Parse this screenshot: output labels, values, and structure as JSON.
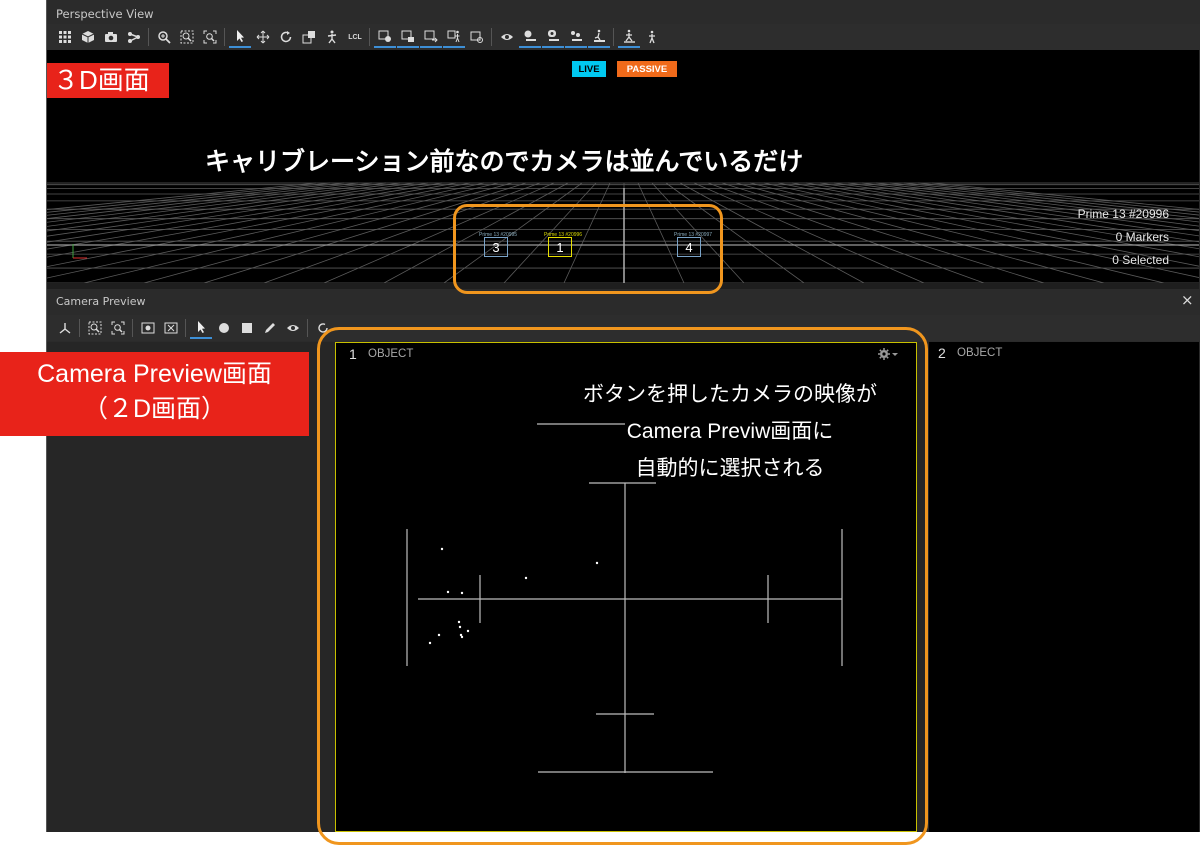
{
  "perspective": {
    "title": "Perspective View",
    "toolbar_icons": [
      "grid-icon",
      "cube-icon",
      "camera-icon",
      "share-icon",
      "zoom-in-icon",
      "zoom-region-icon",
      "zoom-fit-icon",
      "select-arrow-icon",
      "move-icon",
      "rotate-icon",
      "scale-icon",
      "skeleton-icon",
      "lcl-toggle",
      "camera-marker-icon",
      "camera-snapshot-icon",
      "camera-export-icon",
      "body-icon",
      "camera-outline-icon",
      "eye-icon",
      "camera-view-icon",
      "camera-settings-icon",
      "marker-icon",
      "body-run-icon",
      "body-walk-icon",
      "body-stand-icon"
    ],
    "lcl_label": "LCL",
    "live_badge": "LIVE",
    "passive_badge": "PASSIVE",
    "live_color": "#00c8f0",
    "passive_color": "#f06a1a",
    "info": {
      "camera_name": "Prime 13 #20996",
      "markers": "0 Markers",
      "selected": "0 Selected"
    },
    "cameras": [
      {
        "number": "3",
        "tag": "Prime 13 #20995",
        "color": "#7aa4c9"
      },
      {
        "number": "1",
        "tag": "Prime 13 #20996",
        "color": "#e8e000"
      },
      {
        "number": "4",
        "tag": "Prime 13 #20997",
        "color": "#7aa4c9"
      }
    ]
  },
  "camera_preview": {
    "title": "Camera Preview",
    "close_glyph": "×",
    "views": [
      {
        "number": "1",
        "label": "OBJECT"
      },
      {
        "number": "2",
        "label": "OBJECT"
      }
    ]
  },
  "annotations": {
    "label_3d": "３D画面",
    "label_cp_line1": "Camera Preview画面",
    "label_cp_line2": "（２D画面）",
    "note_3d": "キャリブレーション前なのでカメラは並んでいるだけ",
    "note_cp_line1": "ボタンを押したカメラの映像が",
    "note_cp_line2": "Camera Previw画面に",
    "note_cp_line3": "自動的に選択される",
    "accent_orange": "#f0961e",
    "accent_red": "#e8231a"
  }
}
